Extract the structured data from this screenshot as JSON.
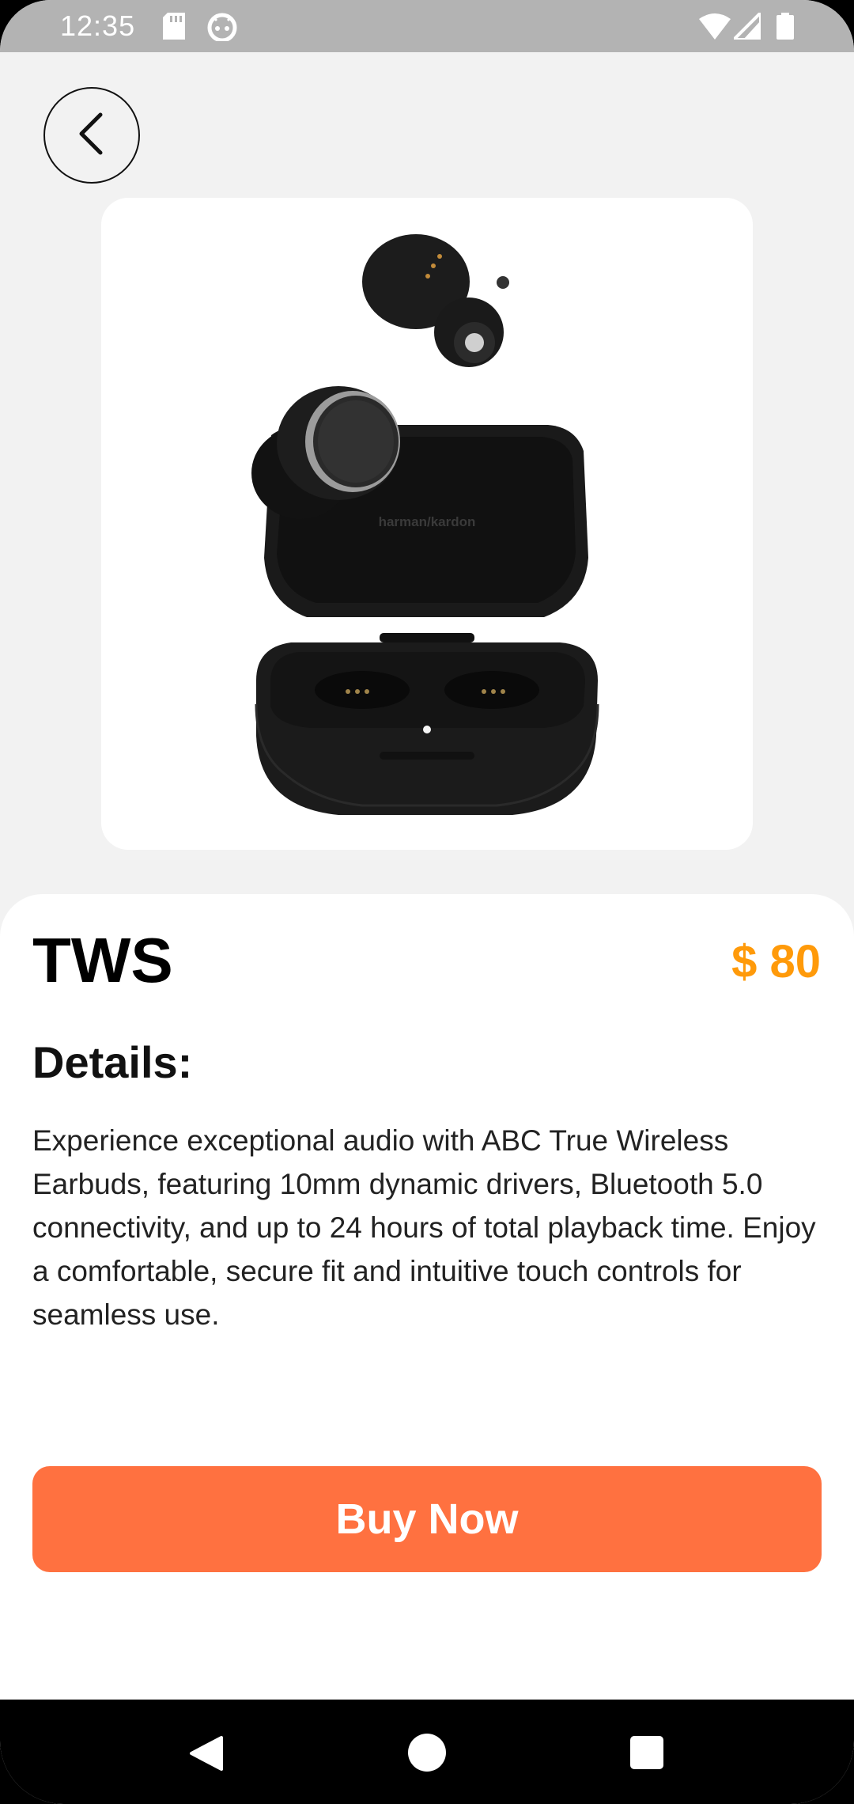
{
  "status_bar": {
    "time": "12:35",
    "left_icons": [
      "sd-card-icon",
      "android-debug-icon"
    ],
    "right_icons": [
      "wifi-icon",
      "cell-signal-icon",
      "battery-icon"
    ]
  },
  "header": {
    "back_icon": "chevron-left-icon"
  },
  "product": {
    "image_alt": "earbuds-with-charging-case",
    "case_brand": "harman/kardon",
    "name": "TWS",
    "price": "$ 80",
    "details_heading": "Details:",
    "description": "Experience exceptional audio with ABC True Wireless Earbuds, featuring 10mm dynamic drivers, Bluetooth 5.0 connectivity, and up to 24 hours of total playback time. Enjoy a comfortable, secure fit and intuitive touch controls for seamless use."
  },
  "actions": {
    "buy_label": "Buy Now"
  },
  "nav_bar": {
    "items": [
      "back-triangle-icon",
      "home-circle-icon",
      "recents-square-icon"
    ]
  },
  "colors": {
    "price": "#ff9a0a",
    "buy_button": "#ff7140",
    "background": "#f2f2f2"
  }
}
